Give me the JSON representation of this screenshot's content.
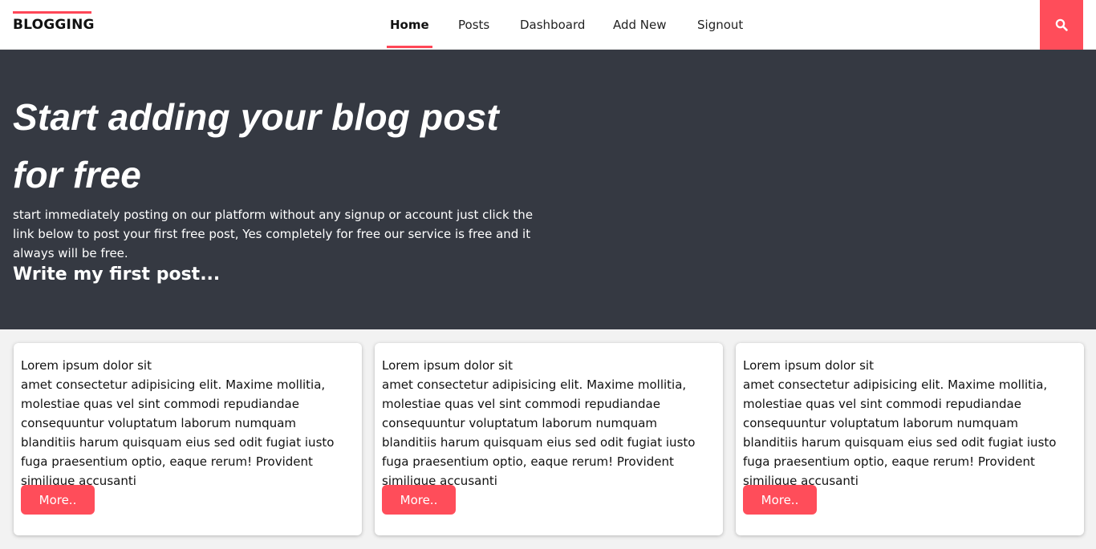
{
  "brand": {
    "name": "BLOGGING",
    "accent": "#ff4757"
  },
  "nav": {
    "items": [
      {
        "label": "Home",
        "active": true
      },
      {
        "label": "Posts",
        "active": false
      },
      {
        "label": "Dashboard",
        "active": false
      },
      {
        "label": "Add New",
        "active": false
      },
      {
        "label": "Signout",
        "active": false
      }
    ],
    "search_icon": "search-icon"
  },
  "hero": {
    "title": "Start adding your blog post for free",
    "text": "start immediately posting on our platform without any signup or account just click the link below to post your first free post, Yes completely for free our service is free and it always will be free.",
    "cta": "Write my first post..."
  },
  "cards": [
    {
      "title": "Lorem ipsum dolor sit",
      "body": "amet consectetur adipisicing elit. Maxime mollitia, molestiae quas vel sint commodi repudiandae consequuntur voluptatum laborum numquam blanditiis harum quisquam eius sed odit fugiat iusto fuga praesentium optio, eaque rerum! Provident similique accusanti",
      "button": "More.."
    },
    {
      "title": "Lorem ipsum dolor sit",
      "body": "amet consectetur adipisicing elit. Maxime mollitia, molestiae quas vel sint commodi repudiandae consequuntur voluptatum laborum numquam blanditiis harum quisquam eius sed odit fugiat iusto fuga praesentium optio, eaque rerum! Provident similique accusanti",
      "button": "More.."
    },
    {
      "title": "Lorem ipsum dolor sit",
      "body": "amet consectetur adipisicing elit. Maxime mollitia, molestiae quas vel sint commodi repudiandae consequuntur voluptatum laborum numquam blanditiis harum quisquam eius sed odit fugiat iusto fuga praesentium optio, eaque rerum! Provident similique accusanti",
      "button": "More.."
    }
  ],
  "colors": {
    "accent": "#ff4d5a",
    "hero_bg": "#353942",
    "page_bg": "#f2f2f2"
  }
}
